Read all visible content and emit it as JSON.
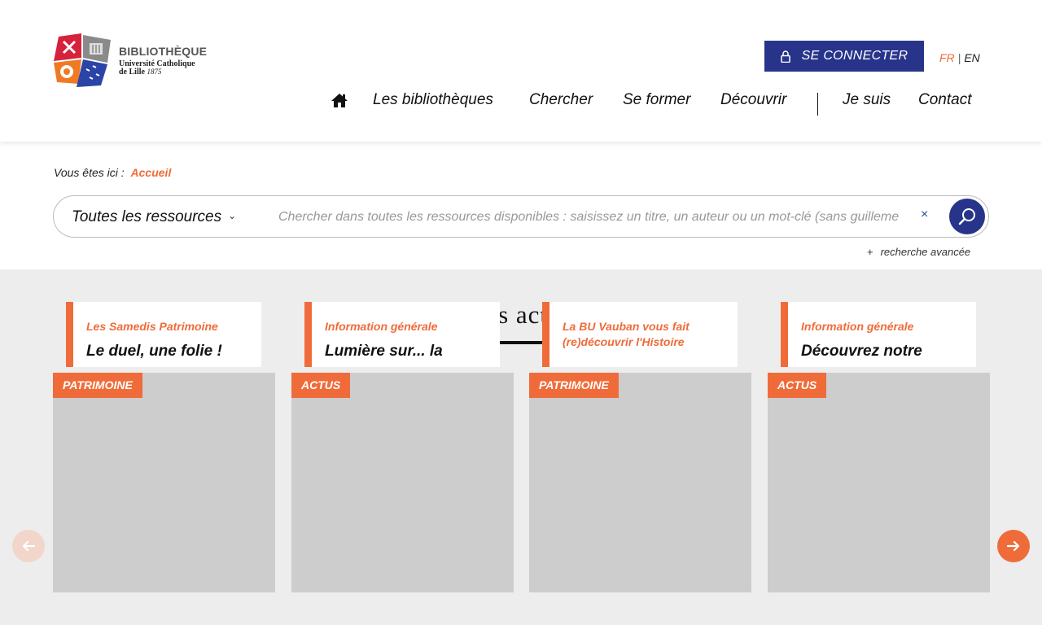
{
  "header": {
    "logo": {
      "title": "BIBLIOTHÈQUE",
      "subtitle": "Université Catholique",
      "city": "de Lille",
      "year": "1875"
    },
    "connect_label": "SE CONNECTER",
    "lang": {
      "fr": "FR",
      "separator": "|",
      "en": "EN"
    },
    "nav": {
      "libraries": "Les bibliothèques",
      "search": "Chercher",
      "training": "Se former",
      "discover": "Découvrir",
      "i_am": "Je suis",
      "contact": "Contact"
    }
  },
  "breadcrumb": {
    "prefix": "Vous êtes ici :",
    "current": "Accueil"
  },
  "search": {
    "scope": "Toutes les ressources",
    "placeholder": "Chercher dans toutes les ressources disponibles : saisissez un titre, un auteur ou un mot-clé (sans guillemets)",
    "clear": "×",
    "advanced_plus": "+",
    "advanced": "recherche avancée"
  },
  "news": {
    "title": "Les actus",
    "cards": [
      {
        "tag": "PATRIMOINE",
        "category": "Les Samedis Patrimoine",
        "headline": "Le duel, une folie !"
      },
      {
        "tag": "ACTUS",
        "category": "Information générale",
        "headline": "Lumière sur... la"
      },
      {
        "tag": "PATRIMOINE",
        "category": "La BU Vauban vous fait (re)découvrir l'Histoire",
        "headline": ""
      },
      {
        "tag": "ACTUS",
        "category": "Information générale",
        "headline": "Découvrez notre"
      }
    ]
  },
  "colors": {
    "accent": "#ef6c3a",
    "brand": "#28348a",
    "section_bg": "#ededed"
  },
  "icons": {
    "home": "home-icon",
    "lock": "lock-icon",
    "search": "search-icon",
    "prev": "arrow-left-icon",
    "next": "arrow-right-icon"
  }
}
